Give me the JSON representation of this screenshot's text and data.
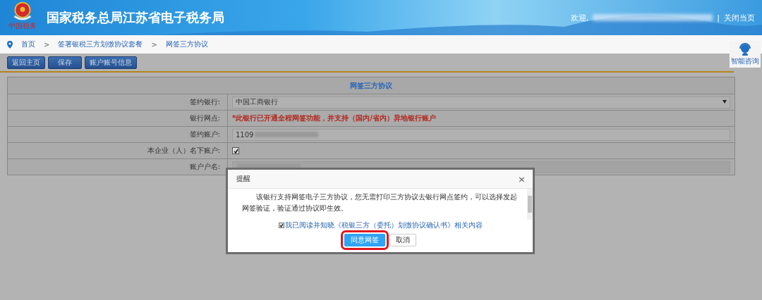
{
  "header": {
    "title": "国家税务总局江苏省电子税务局",
    "logo_caption": "中国税务",
    "welcome": "欢迎,",
    "close_link": "关闭当页",
    "separator": "|"
  },
  "breadcrumb": [
    {
      "label": "首页"
    },
    {
      "label": "签署银税三方划缴协议套餐"
    },
    {
      "label": "网签三方协议"
    }
  ],
  "breadcrumb_separator": ">",
  "toolbar": [
    {
      "label": "返回主页"
    },
    {
      "label": "保存"
    },
    {
      "label": "账户账号信息"
    }
  ],
  "assistant": {
    "label": "智能咨询"
  },
  "form": {
    "title": "网签三方协议",
    "rows": [
      {
        "kind": "select",
        "label": "签约银行:",
        "value": "中国工商银行"
      },
      {
        "kind": "notice",
        "label": "银行网点:",
        "value": "*此银行已开通全程网签功能，并支持（国内/省内）异地银行账户"
      },
      {
        "kind": "input",
        "label": "签约账户:",
        "value": "1109"
      },
      {
        "kind": "checkbox",
        "label": "本企业（人）名下账户:",
        "checked": true
      },
      {
        "kind": "readonly",
        "label": "账户户名:"
      }
    ]
  },
  "dialog": {
    "title": "提醒",
    "close": "×",
    "message": "该银行支持网签电子三方协议，您无需打印三方协议去银行网点签约，可以选择发起网签验证，验证通过协议即生效。",
    "agree": {
      "label": "我已阅读并知晓《税银三方（委托）划缴协议确认书》相关内容",
      "checked": true
    },
    "buttons": [
      {
        "label": "同意网签",
        "kind": "primary"
      },
      {
        "label": "取消",
        "kind": "default"
      }
    ]
  }
}
